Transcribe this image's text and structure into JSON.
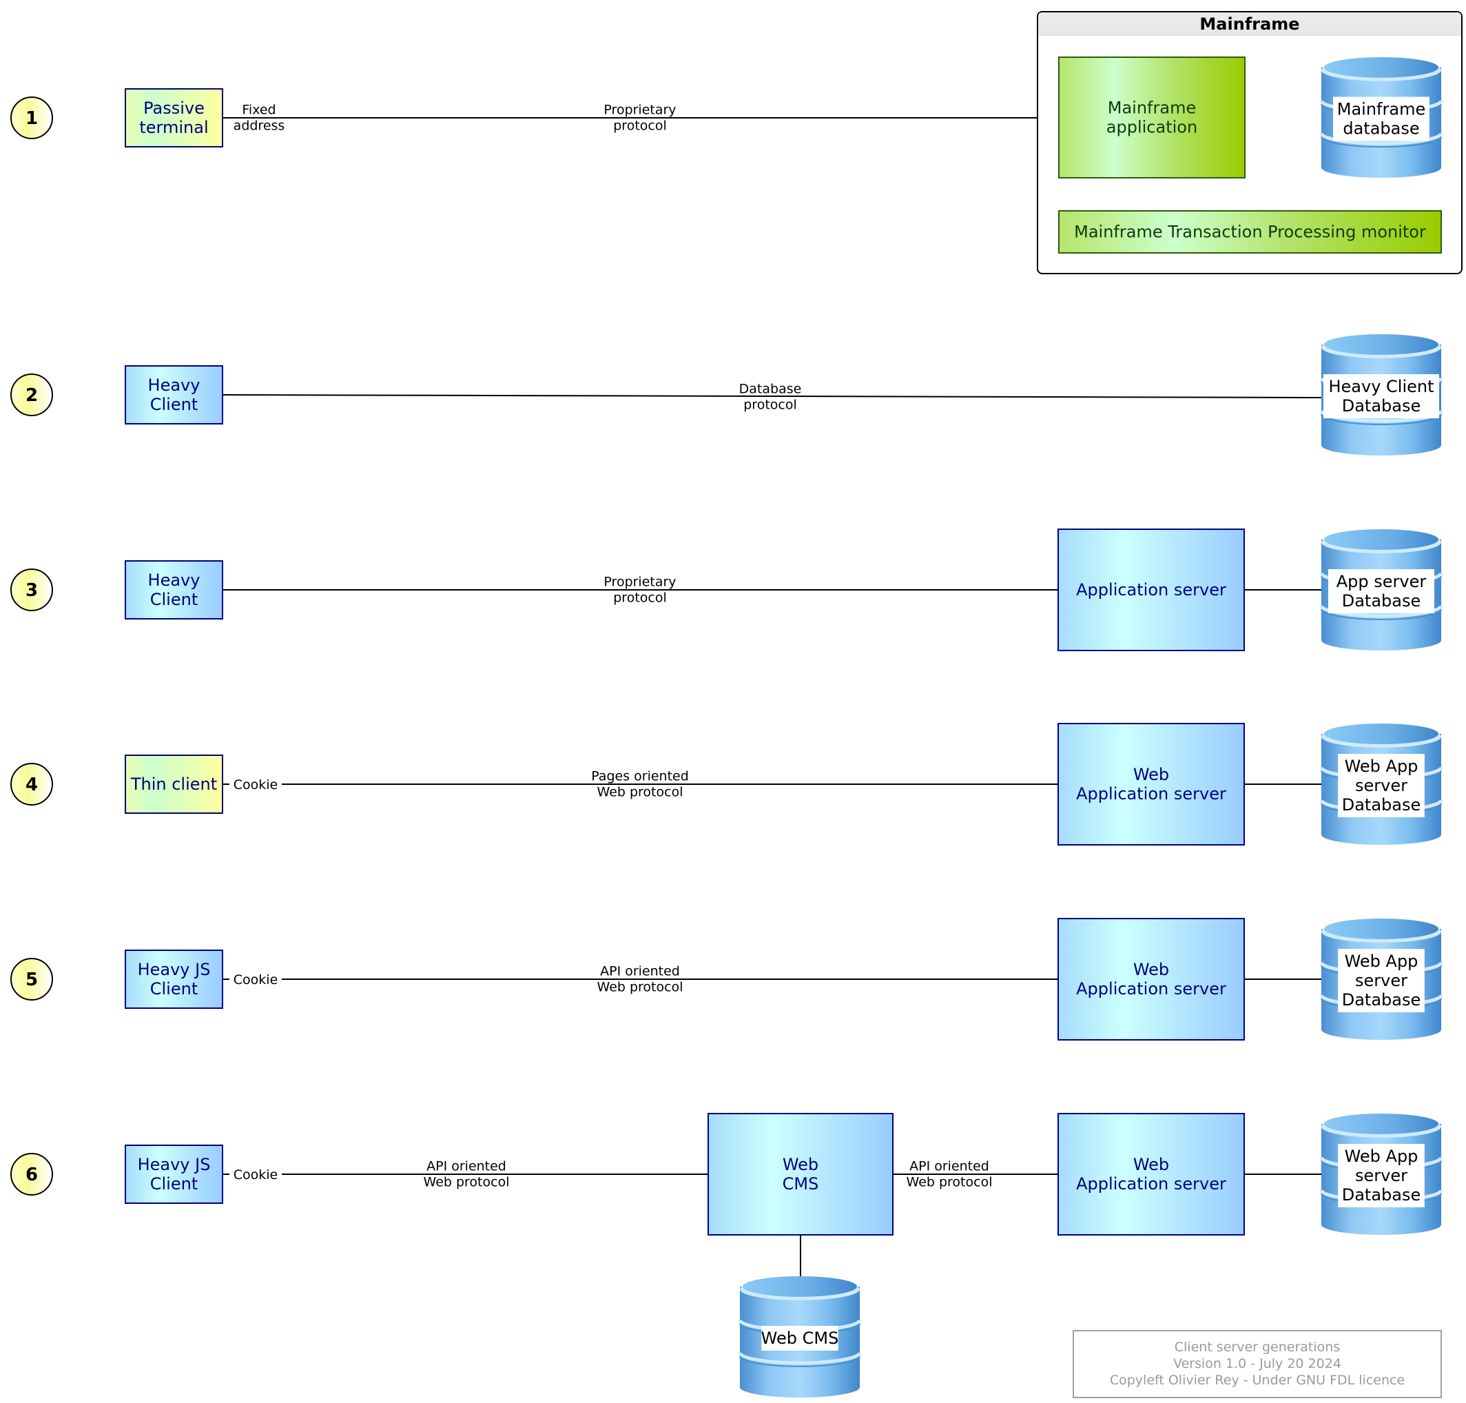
{
  "title": "Client server generations",
  "colors": {
    "client_box_border": "#000080",
    "node_text": "#000080",
    "mainframe_border": "#2d5a0b",
    "db_blue": "#5aa3df",
    "footer_gray": "#9a9a9a",
    "circle_fill": "#fefea0"
  },
  "rows": [
    {
      "number": "1",
      "client": {
        "lines": [
          "Passive",
          "terminal"
        ],
        "style": "yellow-green"
      },
      "client_label": [
        "Fixed",
        "address"
      ],
      "edge_label": [
        "Proprietary",
        "protocol"
      ]
    },
    {
      "number": "2",
      "client": {
        "lines": [
          "Heavy",
          "Client"
        ],
        "style": "blue"
      },
      "edge_label": [
        "Database",
        "protocol"
      ],
      "database": [
        "Heavy Client",
        "Database"
      ]
    },
    {
      "number": "3",
      "client": {
        "lines": [
          "Heavy",
          "Client"
        ],
        "style": "blue"
      },
      "edge_label": [
        "Proprietary",
        "protocol"
      ],
      "server": [
        "Application server"
      ],
      "database": [
        "App server",
        "Database"
      ]
    },
    {
      "number": "4",
      "client": {
        "lines": [
          "Thin client"
        ],
        "style": "yellow-green"
      },
      "client_label": [
        "Cookie"
      ],
      "edge_label": [
        "Pages oriented",
        "Web protocol"
      ],
      "server": [
        "Web",
        "Application server"
      ],
      "database": [
        "Web App",
        "server",
        "Database"
      ]
    },
    {
      "number": "5",
      "client": {
        "lines": [
          "Heavy JS",
          "Client"
        ],
        "style": "blue"
      },
      "client_label": [
        "Cookie"
      ],
      "edge_label": [
        "API oriented",
        "Web protocol"
      ],
      "server": [
        "Web",
        "Application server"
      ],
      "database": [
        "Web App",
        "server",
        "Database"
      ]
    },
    {
      "number": "6",
      "client": {
        "lines": [
          "Heavy JS",
          "Client"
        ],
        "style": "blue"
      },
      "client_label": [
        "Cookie"
      ],
      "edge_label": [
        "API oriented",
        "Web protocol"
      ],
      "cms": [
        "Web",
        "CMS"
      ],
      "cms_edge_label": [
        "API oriented",
        "Web protocol"
      ],
      "cms_database": [
        "Web CMS"
      ],
      "server": [
        "Web",
        "Application server"
      ],
      "database": [
        "Web App",
        "server",
        "Database"
      ]
    }
  ],
  "mainframe": {
    "title": "Mainframe",
    "application": [
      "Mainframe",
      "application"
    ],
    "database": [
      "Mainframe",
      "database"
    ],
    "tp_monitor": [
      "Mainframe Transaction Processing monitor"
    ]
  },
  "footer": {
    "lines": [
      "Client server generations",
      "Version 1.0 - July 20 2024",
      "Copyleft Olivier Rey - Under GNU FDL licence"
    ]
  }
}
